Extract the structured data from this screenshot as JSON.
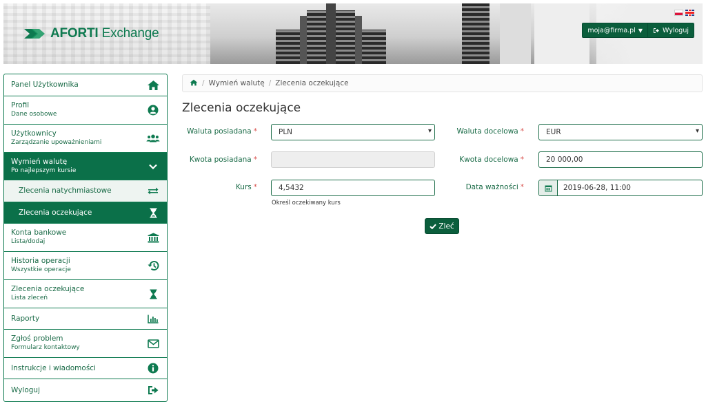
{
  "brand": {
    "name_bold": "AFORTI",
    "name_rest": " Exchange"
  },
  "header": {
    "languages": [
      "pl",
      "en"
    ],
    "user_email": "moja@firma.pl",
    "logout_label": "Wyloguj"
  },
  "sidebar": {
    "items": [
      {
        "title": "Panel Użytkownika",
        "sub": "",
        "icon": "home-icon"
      },
      {
        "title": "Profil",
        "sub": "Dane osobowe",
        "icon": "user-circle-icon"
      },
      {
        "title": "Użytkownicy",
        "sub": "Zarządzanie upoważnieniami",
        "icon": "users-icon"
      },
      {
        "title": "Wymień walutę",
        "sub": "Po najlepszym kursie",
        "icon": "chevron-down-icon"
      },
      {
        "title": "Zlecenia natychmiastowe",
        "sub": "",
        "icon": "exchange-arrows-icon"
      },
      {
        "title": "Zlecenia oczekujące",
        "sub": "",
        "icon": "hourglass-icon"
      },
      {
        "title": "Konta bankowe",
        "sub": "Lista/dodaj",
        "icon": "bank-icon"
      },
      {
        "title": "Historia operacji",
        "sub": "Wszystkie operacje",
        "icon": "history-icon"
      },
      {
        "title": "Zlecenia oczekujące",
        "sub": "Lista zleceń",
        "icon": "hourglass-icon"
      },
      {
        "title": "Raporty",
        "sub": "",
        "icon": "bar-chart-icon"
      },
      {
        "title": "Zgłoś problem",
        "sub": "Formularz kontaktowy",
        "icon": "envelope-icon"
      },
      {
        "title": "Instrukcje i wiadomości",
        "sub": "",
        "icon": "info-icon"
      },
      {
        "title": "Wyloguj",
        "sub": "",
        "icon": "sign-out-icon"
      }
    ]
  },
  "breadcrumb": {
    "items": [
      "Wymień walutę",
      "Zlecenia oczekujące"
    ]
  },
  "page_title": "Zlecenia oczekujące",
  "form": {
    "owned_currency_label": "Waluta posiadana",
    "owned_currency_value": "PLN",
    "target_currency_label": "Waluta docelowa",
    "target_currency_value": "EUR",
    "owned_amount_label": "Kwota posiadana",
    "owned_amount_value": "",
    "target_amount_label": "Kwota docelowa",
    "target_amount_value": "20 000,00",
    "rate_label": "Kurs",
    "rate_value": "4,5432",
    "rate_hint": "Określ oczekiwany kurs",
    "validity_label": "Data ważności",
    "validity_value": "2019-06-28, 11:00",
    "required_mark": "*",
    "submit_label": "Zleć"
  },
  "colors": {
    "primary": "#0b7049",
    "primary_dark": "#0b5e3c",
    "required": "#d9534f"
  }
}
